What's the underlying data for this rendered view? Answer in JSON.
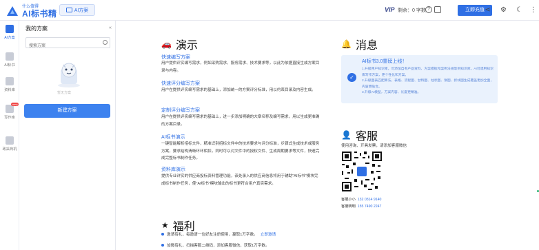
{
  "header": {
    "logo_small": "什么值得",
    "logo_text": "AI标书精灵",
    "ai_tab_label": "AI方案",
    "vip_label": "VIP",
    "balance_label": "剩余：",
    "balance_value": "0 字数",
    "recharge_label": "立即充值",
    "icons": [
      "share-icon",
      "settings-icon",
      "moon-icon",
      "more-icon"
    ]
  },
  "nav": {
    "items": [
      {
        "label": "AI方案",
        "icon": "plan-icon",
        "active": true
      },
      {
        "label": "AI标书",
        "icon": "bid-icon"
      },
      {
        "label": "资料库",
        "icon": "library-icon"
      },
      {
        "label": "写作库",
        "icon": "writing-icon",
        "badge": "new"
      },
      {
        "label": "政采商机",
        "icon": "opportunity-icon"
      }
    ]
  },
  "panel": {
    "title": "我的方案",
    "collapse_glyph": "«",
    "search_placeholder": "搜索方案",
    "empty_text": "暂无方案",
    "new_button": "新建方案"
  },
  "guide": {
    "title": "演示",
    "entries": [
      {
        "title": "快速编写方案",
        "desc": "用户提供评实编写需求，例如采购需求、服务需求、技术要求等，以此为依据直接生成方案目录与内容。"
      },
      {
        "title": "快速评分编写方案",
        "desc": "用户在提供评实编写需求的基础上，添加统一的方案评分标准，用以约束目录及内容生成。"
      },
      {
        "title": "定制评分编写方案",
        "desc": "用户在提供评实编写需求的基础上，进一步添加明确的大章名称及编写需求，用以生成更准确的方案目录。"
      },
      {
        "title": "AI标书演示",
        "desc": "一键智能解析招标文件，精准识别招标文件中的技术要求与评分标准，步骤式生成技术或服务方案，要求结构清晰环环相扣，同时可以对文件中的授权文件、生成周期要求等文件，快速完成完整标书制作任务。"
      },
      {
        "title": "资料库演示",
        "desc": "提供专业详实的供应商投标资料管理功能，该处录入的供应商信息将用于辅助\"AI标书\"模块完成标书制作任务，使\"AI标书\"模块输出的标书更符合用户真实需求。"
      }
    ]
  },
  "messages": {
    "title": "消息",
    "box_title": "AI标书3.0重磅上线！",
    "lines": [
      "1.升级用户知识库，可添加自有产品资料、方案模板和案例法规等到知识库，AI可调用知识库写作方案，更个性化和方案。",
      "2.升级图表匹配算法，表格、流程图、甘特图、柱状图、饼图、折线图生成覆盖更加全面，内容更贴合。",
      "3.升级AI模型，方案内容、长度更精准。"
    ]
  },
  "service": {
    "title": "客服",
    "desc": "使用咨询、开具发票，请添加客服微信",
    "lines": [
      {
        "label": "客服小小",
        "value": "132 0314 9140"
      },
      {
        "label": "客服明明",
        "value": "155 7490 2247"
      }
    ]
  },
  "benefits": {
    "title": "福利",
    "items": [
      {
        "text": "邀请有礼，每邀请一位好友注册使用，赢取1万字数。",
        "link": "立即邀请"
      },
      {
        "text": "加微有礼，扫描客服二维码，添加客服微信，获取1万字数。",
        "link": ""
      }
    ]
  },
  "colors": {
    "accent": "#2f6fe4",
    "page_bg": "#f3f5f9"
  }
}
